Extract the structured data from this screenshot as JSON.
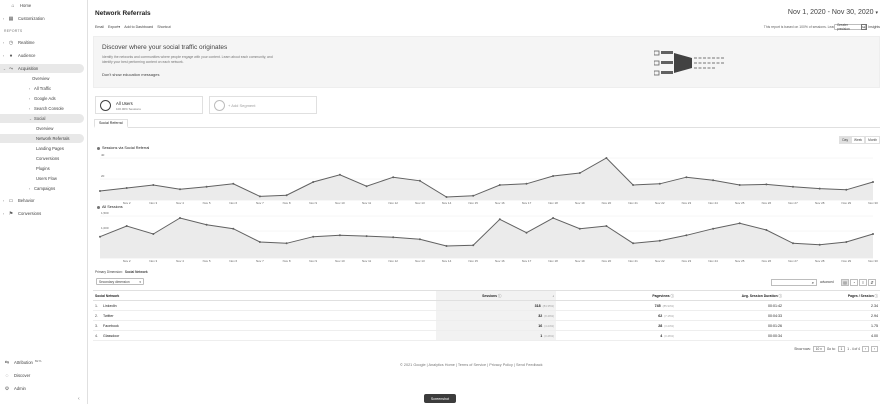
{
  "sidebar": {
    "reports_label": "REPORTS",
    "items": [
      {
        "label": "Home",
        "icon": "home-icon"
      },
      {
        "label": "Customization",
        "icon": "grid-icon"
      },
      {
        "label": "Realtime",
        "icon": "clock-icon"
      },
      {
        "label": "Audience",
        "icon": "person-icon"
      },
      {
        "label": "Acquisition",
        "icon": "acquisition-icon"
      },
      {
        "label": "Overview"
      },
      {
        "label": "All Traffic"
      },
      {
        "label": "Google Ads"
      },
      {
        "label": "Search Console"
      },
      {
        "label": "Social"
      },
      {
        "label": "Overview"
      },
      {
        "label": "Network Referrals"
      },
      {
        "label": "Landing Pages"
      },
      {
        "label": "Conversions"
      },
      {
        "label": "Plugins"
      },
      {
        "label": "Users Flow"
      },
      {
        "label": "Campaigns"
      },
      {
        "label": "Behavior",
        "icon": "behavior-icon"
      },
      {
        "label": "Conversions",
        "icon": "flag-icon"
      }
    ],
    "bottom": [
      {
        "label": "Attribution",
        "badge": "BETA",
        "icon": "attribution-icon"
      },
      {
        "label": "Discover",
        "icon": "lightbulb-icon"
      },
      {
        "label": "Admin",
        "icon": "gear-icon"
      }
    ]
  },
  "header": {
    "title": "Network Referrals",
    "date_range": "Nov 1, 2020 - Nov 30, 2020",
    "toolbar": [
      "Email",
      "Export",
      "Add to Dashboard",
      "Shortcut"
    ],
    "report_note": "This report is based on 100% of sessions. Learn more",
    "precision": "Greater precision",
    "insights": "Insights"
  },
  "banner": {
    "title": "Discover where your social traffic originates",
    "text": "Identify the networks and communities where people engage with your content. Learn about each community, and identify your best performing content on each network.",
    "dismiss": "Don't show education messages"
  },
  "segments": {
    "active_name": "All Users",
    "active_sub": "100.00% Sessions",
    "add_label": "+ Add Segment"
  },
  "tab": "Social Referral",
  "granularity": [
    "Day",
    "Week",
    "Month"
  ],
  "charts": {
    "social_legend": "Sessions via Social Referral",
    "all_legend": "All Sessions"
  },
  "chart_data": [
    {
      "type": "line",
      "title": "",
      "series": [
        {
          "name": "Sessions via Social Referral",
          "values": [
            15,
            20,
            25,
            18,
            22,
            27,
            6,
            8,
            30,
            42,
            23,
            38,
            32,
            5,
            7,
            25,
            27,
            40,
            45,
            70,
            25,
            27,
            38,
            33,
            25,
            26,
            22,
            19,
            17,
            30
          ]
        }
      ],
      "x": [
        "Nov 1",
        "Nov 2",
        "Nov 3",
        "Nov 4",
        "Nov 5",
        "Nov 6",
        "Nov 7",
        "Nov 8",
        "Nov 9",
        "Nov 10",
        "Nov 11",
        "Nov 12",
        "Nov 13",
        "Nov 14",
        "Nov 15",
        "Nov 16",
        "Nov 17",
        "Nov 18",
        "Nov 19",
        "Nov 20",
        "Nov 21",
        "Nov 22",
        "Nov 23",
        "Nov 24",
        "Nov 25",
        "Nov 26",
        "Nov 27",
        "Nov 28",
        "Nov 29",
        "Nov 30"
      ],
      "x_ticks": [
        "Nov 2",
        "Nov 3",
        "Nov 4",
        "Nov 5",
        "Nov 6",
        "Nov 7",
        "Nov 8",
        "Nov 9",
        "Nov 10",
        "Nov 11",
        "Nov 12",
        "Nov 13",
        "Nov 14",
        "Nov 15",
        "Nov 16",
        "Nov 17",
        "Nov 18",
        "Nov 19",
        "Nov 20",
        "Nov 21",
        "Nov 22",
        "Nov 23",
        "Nov 24",
        "Nov 25",
        "Nov 26",
        "Nov 27",
        "Nov 28",
        "Nov 29",
        "Nov 30"
      ],
      "y_ticks": [
        "40",
        "20"
      ],
      "ylim": [
        0,
        80
      ]
    },
    {
      "type": "line",
      "title": "",
      "series": [
        {
          "name": "All Sessions",
          "values": [
            800,
            1200,
            900,
            1500,
            1250,
            1100,
            600,
            550,
            800,
            850,
            820,
            780,
            700,
            450,
            480,
            1450,
            950,
            1500,
            1100,
            1200,
            550,
            650,
            850,
            1100,
            1300,
            1050,
            550,
            500,
            600,
            900
          ]
        }
      ],
      "x": [
        "Nov 1",
        "Nov 2",
        "Nov 3",
        "Nov 4",
        "Nov 5",
        "Nov 6",
        "Nov 7",
        "Nov 8",
        "Nov 9",
        "Nov 10",
        "Nov 11",
        "Nov 12",
        "Nov 13",
        "Nov 14",
        "Nov 15",
        "Nov 16",
        "Nov 17",
        "Nov 18",
        "Nov 19",
        "Nov 20",
        "Nov 21",
        "Nov 22",
        "Nov 23",
        "Nov 24",
        "Nov 25",
        "Nov 26",
        "Nov 27",
        "Nov 28",
        "Nov 29",
        "Nov 30"
      ],
      "x_ticks": [
        "Nov 2",
        "Nov 3",
        "Nov 4",
        "Nov 5",
        "Nov 6",
        "Nov 7",
        "Nov 8",
        "Nov 9",
        "Nov 10",
        "Nov 11",
        "Nov 12",
        "Nov 13",
        "Nov 14",
        "Nov 15",
        "Nov 16",
        "Nov 17",
        "Nov 18",
        "Nov 19",
        "Nov 20",
        "Nov 21",
        "Nov 22",
        "Nov 23",
        "Nov 24",
        "Nov 25",
        "Nov 26",
        "Nov 27",
        "Nov 28",
        "Nov 29",
        "Nov 30"
      ],
      "y_ticks": [
        "1,500",
        "1,000",
        "500"
      ],
      "ylim": [
        0,
        1800
      ]
    }
  ],
  "table_controls": {
    "primary_dimension": "Primary Dimension:",
    "primary_value": "Social Network",
    "secondary_dimension": "Secondary dimension",
    "advanced": "advanced"
  },
  "table": {
    "headers": [
      "Social Network",
      "Sessions",
      "Pageviews",
      "Avg. Session Duration",
      "Pages / Session"
    ],
    "rows": [
      {
        "num": "1.",
        "network": "LinkedIn",
        "sessions": "318",
        "sessions_pct": "(84.35%)",
        "pageviews": "745",
        "pageviews_pct": "(85.93%)",
        "duration": "00:01:42",
        "pps": "2.34"
      },
      {
        "num": "2.",
        "network": "Twitter",
        "sessions": "32",
        "sessions_pct": "(8.49%)",
        "pageviews": "62",
        "pageviews_pct": "(7.15%)",
        "duration": "00:04:33",
        "pps": "2.94"
      },
      {
        "num": "3.",
        "network": "Facebook",
        "sessions": "16",
        "sessions_pct": "(4.24%)",
        "pageviews": "28",
        "pageviews_pct": "(3.23%)",
        "duration": "00:01:26",
        "pps": "1.75"
      },
      {
        "num": "4.",
        "network": "Glassdoor",
        "sessions": "1",
        "sessions_pct": "(0.26%)",
        "pageviews": "4",
        "pageviews_pct": "(0.46%)",
        "duration": "00:00:34",
        "pps": "4.00"
      }
    ]
  },
  "pager": {
    "show_rows": "Show rows:",
    "rows_value": "10",
    "goto": "Go to:",
    "goto_value": "1",
    "range": "1 - 4 of 4"
  },
  "footer": "© 2021 Google | Analytics Home | Terms of Service | Privacy Policy | Send Feedback",
  "screenshot_button": "Screenshot"
}
